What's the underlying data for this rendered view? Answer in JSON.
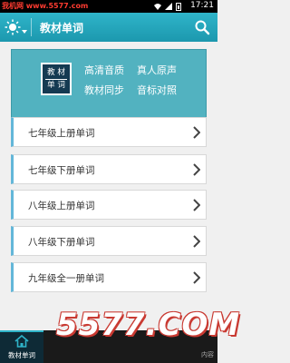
{
  "status_bar": {
    "watermark_text": "我机网 www.5577.com",
    "time": "17:21"
  },
  "titlebar": {
    "title": "教材单词",
    "left_icon": "brightness-icon",
    "right_icon": "search-icon",
    "accent_color": "#1fa6bc"
  },
  "banner": {
    "book_top": "教 材",
    "book_bottom": "单 词",
    "features": [
      "高清音质",
      "真人原声",
      "教材同步",
      "音标对照"
    ],
    "background": "#52b2c0"
  },
  "list": {
    "items": [
      {
        "label": "七年级上册单词"
      },
      {
        "label": "七年级下册单词"
      },
      {
        "label": "八年级上册单词"
      },
      {
        "label": "八年级下册单词"
      },
      {
        "label": "九年级全一册单词"
      }
    ]
  },
  "bottom_nav": {
    "home_label": "教材单词",
    "right_partial": "内容"
  },
  "overlay_watermark": "5577.COM"
}
